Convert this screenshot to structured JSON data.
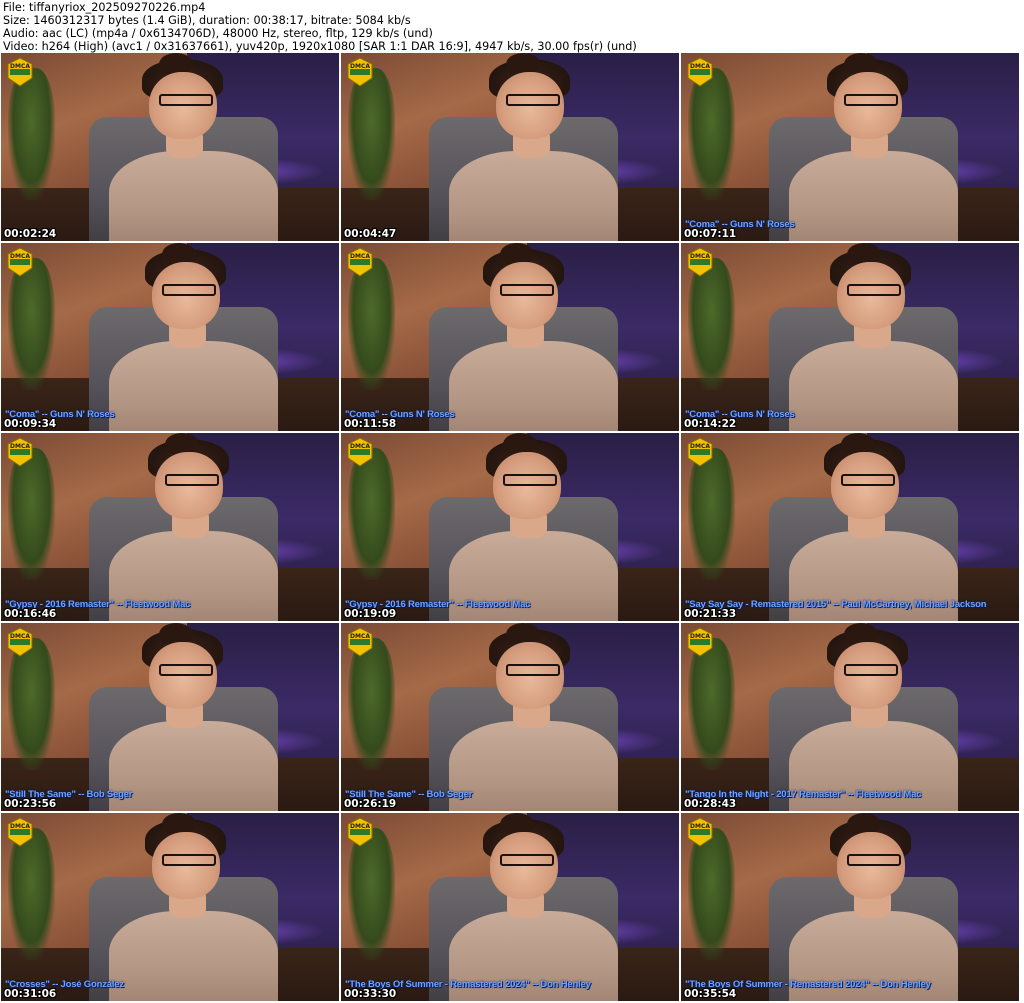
{
  "header": {
    "line1": "File: tiffanyriox_202509270226.mp4",
    "line2": "Size: 1460312317 bytes (1.4 GiB), duration: 00:38:17, bitrate: 5084 kb/s",
    "line3": "Audio: aac (LC) (mp4a / 0x6134706D), 48000 Hz, stereo, fltp, 129 kb/s (und)",
    "line4": "Video: h264 (High) (avc1 / 0x31637661), yuv420p, 1920x1080 [SAR 1:1 DAR 16:9], 4947 kb/s, 30.00 fps(r) (und)"
  },
  "badge": {
    "text": "DMCA",
    "color": "#f2c200",
    "icon": "dmca-protected-badge"
  },
  "thumbnails": [
    {
      "timestamp": "00:02:24",
      "song": ""
    },
    {
      "timestamp": "00:04:47",
      "song": ""
    },
    {
      "timestamp": "00:07:11",
      "song": "\"Coma\" -- Guns N' Roses"
    },
    {
      "timestamp": "00:09:34",
      "song": "\"Coma\" -- Guns N' Roses"
    },
    {
      "timestamp": "00:11:58",
      "song": "\"Coma\" -- Guns N' Roses"
    },
    {
      "timestamp": "00:14:22",
      "song": "\"Coma\" -- Guns N' Roses"
    },
    {
      "timestamp": "00:16:46",
      "song": "\"Gypsy - 2016 Remaster\" -- Fleetwood Mac"
    },
    {
      "timestamp": "00:19:09",
      "song": "\"Gypsy - 2016 Remaster\" -- Fleetwood Mac"
    },
    {
      "timestamp": "00:21:33",
      "song": "\"Say Say Say - Remastered 2015\" -- Paul McCartney, Michael Jackson"
    },
    {
      "timestamp": "00:23:56",
      "song": "\"Still The Same\" -- Bob Seger"
    },
    {
      "timestamp": "00:26:19",
      "song": "\"Still The Same\" -- Bob Seger"
    },
    {
      "timestamp": "00:28:43",
      "song": "\"Tango In the Night - 2017 Remaster\" -- Fleetwood Mac"
    },
    {
      "timestamp": "00:31:06",
      "song": "\"Crosses\" -- José González"
    },
    {
      "timestamp": "00:33:30",
      "song": "\"The Boys Of Summer - Remastered 2024\" -- Don Henley"
    },
    {
      "timestamp": "00:35:54",
      "song": "\"The Boys Of Summer - Remastered 2024\" -- Don Henley"
    }
  ]
}
